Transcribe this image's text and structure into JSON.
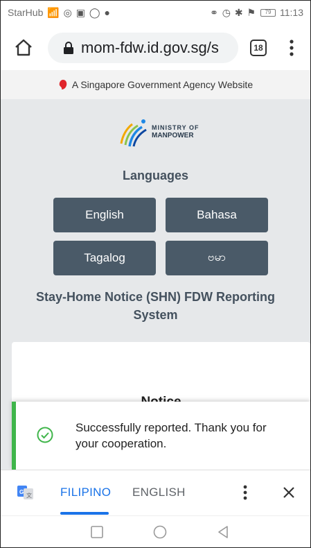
{
  "status_bar": {
    "carrier": "StarHub",
    "left_icons": "📶 ◎ ▣ ◯ ●",
    "right_icons": "⚭ ◷ ✱ ⚑",
    "battery": "79",
    "time": "11:13"
  },
  "browser": {
    "url": "mom-fdw.id.gov.sg/s",
    "tab_count": "18"
  },
  "gov_banner": {
    "text": "A Singapore Government Agency Website"
  },
  "logo": {
    "line1": "MINISTRY OF",
    "line2": "MANPOWER"
  },
  "languages": {
    "title": "Languages",
    "buttons": [
      "English",
      "Bahasa",
      "Tagalog",
      "ဗမာ"
    ]
  },
  "system_title": "Stay-Home Notice (SHN) FDW Reporting System",
  "card": {
    "title": "Notice"
  },
  "snackbar": {
    "message": "Successfully reported. Thank you for your cooperation.",
    "status_color": "#3fb54a"
  },
  "translate_bar": {
    "tabs": [
      "FILIPINO",
      "ENGLISH"
    ],
    "active_tab": "FILIPINO"
  },
  "colors": {
    "button_bg": "#4a5a68",
    "heading": "#44515e",
    "accent": "#1a73e8",
    "content_bg": "#e6e8ea"
  }
}
